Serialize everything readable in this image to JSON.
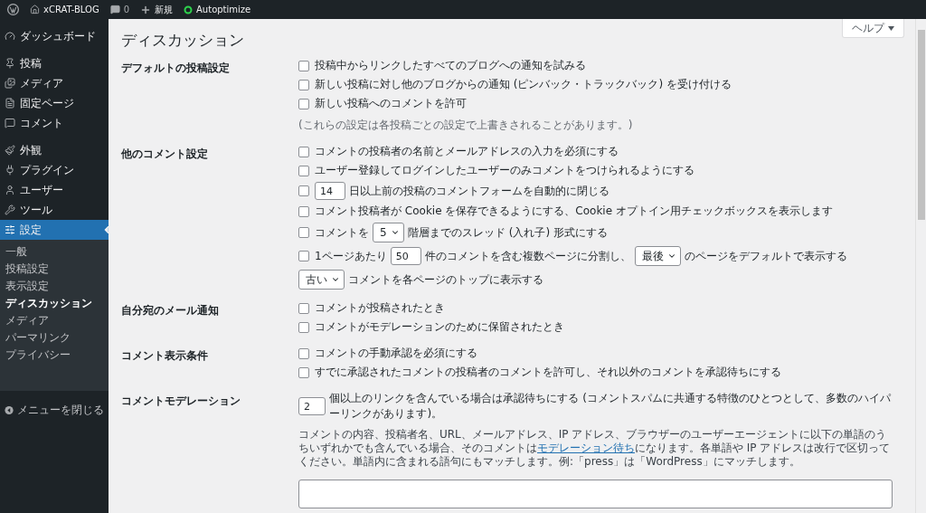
{
  "admin_bar": {
    "site": "xCRAT-BLOG",
    "comments": "0",
    "new": "新規",
    "plugin": "Autoptimize"
  },
  "sidebar": {
    "groups": [
      [
        {
          "label": "ダッシュボード",
          "selected": false
        }
      ],
      [
        {
          "label": "投稿",
          "selected": false
        },
        {
          "label": "メディア",
          "selected": false
        },
        {
          "label": "固定ページ",
          "selected": false
        },
        {
          "label": "コメント",
          "selected": false
        }
      ],
      [
        {
          "label": "外観",
          "selected": false
        },
        {
          "label": "プラグイン",
          "selected": false
        },
        {
          "label": "ユーザー",
          "selected": false
        },
        {
          "label": "ツール",
          "selected": false
        },
        {
          "label": "設定",
          "selected": true
        }
      ]
    ],
    "submenu": [
      {
        "label": "一般",
        "selected": false
      },
      {
        "label": "投稿設定",
        "selected": false
      },
      {
        "label": "表示設定",
        "selected": false
      },
      {
        "label": "ディスカッション",
        "selected": true
      },
      {
        "label": "メディア",
        "selected": false
      },
      {
        "label": "パーマリンク",
        "selected": false
      },
      {
        "label": "プライバシー",
        "selected": false
      }
    ],
    "collapse": "メニューを閉じる"
  },
  "help_button": "ヘルプ",
  "title": "ディスカッション",
  "sections": [
    {
      "label": "デフォルトの投稿設定",
      "rows": [
        {
          "checked": false,
          "parts": [
            {
              "kind": "text",
              "value": "投稿中からリンクしたすべてのブログへの通知を試みる"
            }
          ]
        },
        {
          "checked": false,
          "parts": [
            {
              "kind": "text",
              "value": "新しい投稿に対し他のブログからの通知 (ピンバック・トラックバック) を受け付ける"
            }
          ]
        },
        {
          "checked": false,
          "parts": [
            {
              "kind": "text",
              "value": "新しい投稿へのコメントを許可"
            }
          ]
        }
      ],
      "note": "(これらの設定は各投稿ごとの設定で上書きされることがあります。)"
    },
    {
      "label": "他のコメント設定",
      "rows": [
        {
          "checked": false,
          "parts": [
            {
              "kind": "text",
              "value": "コメントの投稿者の名前とメールアドレスの入力を必須にする"
            }
          ]
        },
        {
          "checked": false,
          "parts": [
            {
              "kind": "text",
              "value": "ユーザー登録してログインしたユーザーのみコメントをつけられるようにする"
            }
          ]
        },
        {
          "checked": false,
          "parts": [
            {
              "kind": "input",
              "value": "14"
            },
            {
              "kind": "text",
              "value": "日以上前の投稿のコメントフォームを自動的に閉じる"
            }
          ]
        },
        {
          "checked": false,
          "parts": [
            {
              "kind": "text",
              "value": "コメント投稿者が Cookie を保存できるようにする、Cookie オプトイン用チェックボックスを表示します"
            }
          ]
        },
        {
          "checked": false,
          "parts": [
            {
              "kind": "text",
              "value": "コメントを"
            },
            {
              "kind": "select",
              "value": "5"
            },
            {
              "kind": "text",
              "value": "階層までのスレッド (入れ子) 形式にする"
            }
          ]
        },
        {
          "checked": false,
          "parts": [
            {
              "kind": "text",
              "value": "1ページあたり"
            },
            {
              "kind": "input",
              "value": "50"
            },
            {
              "kind": "text",
              "value": "件のコメントを含む複数ページに分割し、"
            },
            {
              "kind": "select",
              "value": "最後"
            },
            {
              "kind": "text",
              "value": "のページをデフォルトで表示する"
            }
          ]
        },
        {
          "parts": [
            {
              "kind": "select",
              "value": "古い"
            },
            {
              "kind": "text",
              "value": "コメントを各ページのトップに表示する"
            }
          ]
        }
      ]
    },
    {
      "label": "自分宛のメール通知",
      "rows": [
        {
          "checked": false,
          "parts": [
            {
              "kind": "text",
              "value": "コメントが投稿されたとき"
            }
          ]
        },
        {
          "checked": false,
          "parts": [
            {
              "kind": "text",
              "value": "コメントがモデレーションのために保留されたとき"
            }
          ]
        }
      ]
    },
    {
      "label": "コメント表示条件",
      "rows": [
        {
          "checked": false,
          "parts": [
            {
              "kind": "text",
              "value": "コメントの手動承認を必須にする"
            }
          ]
        },
        {
          "checked": false,
          "parts": [
            {
              "kind": "text",
              "value": "すでに承認されたコメントの投稿者のコメントを許可し、それ以外のコメントを承認待ちにする"
            }
          ]
        }
      ]
    },
    {
      "label": "コメントモデレーション",
      "rows": [
        {
          "parts": [
            {
              "kind": "input",
              "value": "2"
            },
            {
              "kind": "text",
              "value": "個以上のリンクを含んでいる場合は承認待ちにする (コメントスパムに共通する特徴のひとつとして、多数のハイパーリンクがあります)。"
            }
          ]
        }
      ],
      "paragraph": {
        "before": "コメントの内容、投稿者名、URL、メールアドレス、IP アドレス、ブラウザーのユーザーエージェントに以下の単語のうちいずれかでも含んでいる場合、そのコメントは",
        "link": "モデレーション待ち",
        "after": "になります。各単語や IP アドレスは改行で区切ってください。単語内に含まれる語句にもマッチします。例:「press」は「WordPress」にマッチします。"
      }
    }
  ]
}
